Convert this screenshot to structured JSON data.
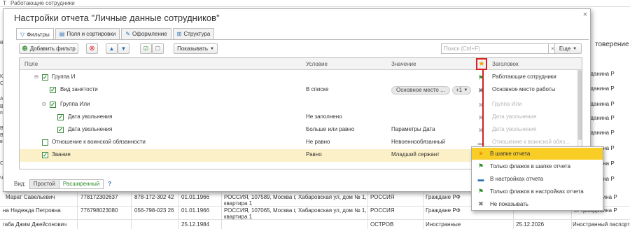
{
  "background": {
    "top_title": "Работающие сотрудники",
    "top_prefix": "Т",
    "left_fragments": [
      "В",
      "Кли",
      "С",
      "Ант",
      "В",
      "по П",
      "В И",
      "В",
      "в А",
      "Св",
      "Ч"
    ],
    "right_header": "товерение л",
    "right_fragments": [
      "ет гражданина Р",
      "ет гражданина Р",
      "ет гражданина Р",
      "ет гражданина Р",
      "ет гражданина Р",
      "ет гражданина Р",
      "ет гражданина Р",
      "ет гражданина Р"
    ],
    "rows": [
      {
        "name": "Марат Савельевич",
        "inn": "778172302637",
        "phone": "878-172-302 42",
        "date": "01.01.1966",
        "address": "РОССИЯ, 107589, Москва г, Хабаровская ул, дом № 1, квартира 1",
        "country": "РОССИЯ",
        "citizenship": "Граждане РФ",
        "doc": "ет гражданина Р"
      },
      {
        "name": "на Надежда Петровна",
        "inn": "776798023080",
        "phone": "056-798-023 26",
        "date": "01.01.1966",
        "address": "РОССИЯ, 107065, Москва г, Хабаровская ул, дом № 1, квартира 1",
        "country": "РОССИЯ",
        "citizenship": "Граждане РФ",
        "doc": "ет гражданина Р"
      },
      {
        "name": "габа Джим Джейсонович",
        "inn": "",
        "phone": "",
        "date": "25.12.1984",
        "address": "",
        "country": "ОСТРОВ",
        "citizenship": "Иностранные",
        "issue_date": "25.12.2026",
        "doc": "Иностранный паспорт"
      }
    ]
  },
  "dialog": {
    "title": "Настройки отчета \"Личные данные сотрудников\"",
    "close": "×",
    "tabs": [
      {
        "label": "Фильтры",
        "icon": "filter-icon"
      },
      {
        "label": "Поля и сортировки",
        "icon": "fields-icon"
      },
      {
        "label": "Оформление",
        "icon": "brush-icon"
      },
      {
        "label": "Структура",
        "icon": "structure-icon"
      }
    ],
    "toolbar": {
      "add_filter": "Добавить фильтр",
      "show": "Показывать",
      "search_placeholder": "Поиск (Ctrl+F)",
      "clear": "×",
      "more": "Еще"
    },
    "table": {
      "columns": {
        "field": "Поле",
        "condition": "Условие",
        "value": "Значение",
        "star": "★",
        "title": "Заголовок"
      },
      "rows": [
        {
          "field": "Группа И",
          "condition": "",
          "value": "",
          "title": "Работающие сотрудники"
        },
        {
          "field": "Вид занятости",
          "condition": "В списке",
          "value": "Основное место ...",
          "badge": "+1",
          "title": "Основное место работы"
        },
        {
          "field": "Группа Или",
          "condition": "",
          "value": "",
          "title": "Группа Или"
        },
        {
          "field": "Дата увольнения",
          "condition": "Не заполнено",
          "value": "",
          "title": "Дата увольнения"
        },
        {
          "field": "Дата увольнения",
          "condition": "Больше или равно",
          "value": "Параметры Дата",
          "title": "Дата увольнения"
        },
        {
          "field": "Отношение к воинской обязанности",
          "condition": "Не равно",
          "value": "Невоеннообязанный",
          "title": "Отношение к воинской обяз..."
        },
        {
          "field": "Звание",
          "condition": "Равно",
          "value": "Младший сержант",
          "title": ""
        }
      ]
    },
    "footer": {
      "view_label": "Вид:",
      "simple": "Простой",
      "extended": "Расширенный",
      "help": "?"
    }
  },
  "menu": {
    "items": [
      {
        "label": "В шапке отчета",
        "icon": "star-icon"
      },
      {
        "label": "Только флажок в шапке отчета",
        "icon": "flag-header-icon"
      },
      {
        "label": "В настройках отчета",
        "icon": "settings-line-icon"
      },
      {
        "label": "Только флажок в настройках отчета",
        "icon": "flag-settings-icon"
      },
      {
        "label": "Не показывать",
        "icon": "cross-icon"
      }
    ]
  },
  "colors": {
    "accent_yellow": "#f7cd26",
    "arrow_red": "#d82020",
    "green": "#2f8f2f",
    "selected_row": "#fbf0c8"
  }
}
